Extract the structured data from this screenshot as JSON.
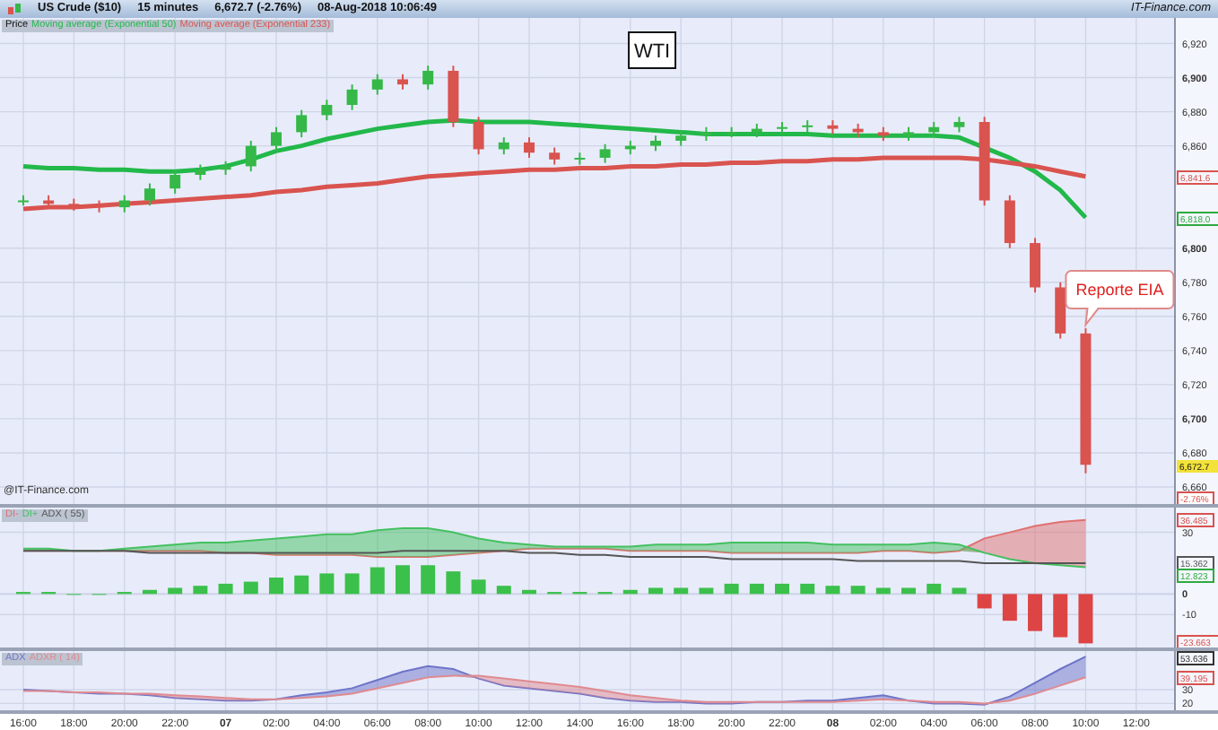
{
  "header": {
    "instrument": "US Crude ($10)",
    "interval": "15 minutes",
    "quote": "6,672.7 (-2.76%)",
    "timestamp": "08-Aug-2018 10:06:49",
    "site": "IT-Finance.com"
  },
  "price_panel": {
    "credit": "@IT-Finance.com",
    "price_legend": "Price",
    "tags": [
      {
        "label": "6,841.6",
        "kind": "outline",
        "color": "#d9534f"
      },
      {
        "label": "6,818.0",
        "kind": "outline",
        "color": "#2eaa40"
      },
      {
        "label": "6,672.7",
        "kind": "filled",
        "color": "#f2e23a"
      },
      {
        "label": "-2.76%",
        "kind": "change",
        "color": "#d9534f"
      }
    ],
    "chart_data": {
      "type": "candlestick",
      "title": "WTI",
      "grid": true,
      "ylim": [
        6650,
        6935
      ],
      "categories": [
        null,
        null,
        null,
        null,
        null,
        null,
        null,
        null,
        null,
        null,
        null,
        null,
        null,
        null,
        null,
        null,
        null,
        null,
        null,
        null,
        null,
        null,
        null,
        null,
        null,
        null,
        null,
        null,
        null,
        null,
        null,
        null,
        null,
        null,
        null,
        null,
        null,
        null,
        null,
        null,
        null,
        null,
        null
      ],
      "yticks": [
        {
          "value": 6920,
          "label": "6,920"
        },
        {
          "value": 6900,
          "label": "6,900"
        },
        {
          "value": 6880,
          "label": "6,880"
        },
        {
          "value": 6860,
          "label": "6,860"
        },
        {
          "value": 6800,
          "label": "6,800"
        },
        {
          "value": 6780,
          "label": "6,780"
        },
        {
          "value": 6760,
          "label": "6,760"
        },
        {
          "value": 6740,
          "label": "6,740"
        },
        {
          "value": 6720,
          "label": "6,720"
        },
        {
          "value": 6700,
          "label": "6,700"
        },
        {
          "value": 6680,
          "label": "6,680"
        },
        {
          "value": 6660,
          "label": "6,660"
        }
      ],
      "ohlc": [
        [
          6828,
          6831,
          6825,
          6828
        ],
        [
          6828,
          6831,
          6823,
          6826
        ],
        [
          6826,
          6829,
          6822,
          6825
        ],
        [
          6825,
          6828,
          6821,
          6824
        ],
        [
          6824,
          6831,
          6821,
          6828
        ],
        [
          6828,
          6838,
          6825,
          6835
        ],
        [
          6835,
          6846,
          6832,
          6843
        ],
        [
          6843,
          6849,
          6840,
          6846
        ],
        [
          6846,
          6851,
          6843,
          6848
        ],
        [
          6848,
          6863,
          6845,
          6860
        ],
        [
          6860,
          6871,
          6857,
          6868
        ],
        [
          6868,
          6881,
          6865,
          6878
        ],
        [
          6878,
          6887,
          6875,
          6884
        ],
        [
          6884,
          6896,
          6881,
          6893
        ],
        [
          6893,
          6902,
          6890,
          6899
        ],
        [
          6899,
          6902,
          6893,
          6896
        ],
        [
          6896,
          6907,
          6893,
          6904
        ],
        [
          6904,
          6907,
          6871,
          6874
        ],
        [
          6874,
          6877,
          6855,
          6858
        ],
        [
          6858,
          6865,
          6855,
          6862
        ],
        [
          6862,
          6865,
          6853,
          6856
        ],
        [
          6856,
          6859,
          6849,
          6852
        ],
        [
          6852,
          6856,
          6849,
          6853
        ],
        [
          6853,
          6861,
          6850,
          6858
        ],
        [
          6858,
          6863,
          6855,
          6860
        ],
        [
          6860,
          6866,
          6857,
          6863
        ],
        [
          6863,
          6869,
          6860,
          6866
        ],
        [
          6866,
          6871,
          6863,
          6868
        ],
        [
          6868,
          6871,
          6865,
          6868
        ],
        [
          6868,
          6873,
          6865,
          6870
        ],
        [
          6870,
          6874,
          6867,
          6871
        ],
        [
          6871,
          6875,
          6868,
          6872
        ],
        [
          6872,
          6875,
          6867,
          6870
        ],
        [
          6870,
          6873,
          6865,
          6868
        ],
        [
          6868,
          6871,
          6863,
          6866
        ],
        [
          6866,
          6871,
          6863,
          6868
        ],
        [
          6868,
          6874,
          6865,
          6871
        ],
        [
          6871,
          6877,
          6868,
          6874
        ],
        [
          6874,
          6877,
          6825,
          6828
        ],
        [
          6828,
          6831,
          6800,
          6803
        ],
        [
          6803,
          6806,
          6774,
          6777
        ],
        [
          6777,
          6780,
          6747,
          6750
        ],
        [
          6750,
          6753,
          6668,
          6673
        ]
      ],
      "series": [
        {
          "name": "Moving average (Exponential 50)",
          "type": "line",
          "color": "#22b84a",
          "values": [
            6848,
            6847,
            6847,
            6846,
            6846,
            6845,
            6845,
            6846,
            6848,
            6852,
            6857,
            6860,
            6864,
            6867,
            6870,
            6872,
            6874,
            6875,
            6874,
            6874,
            6874,
            6873,
            6872,
            6871,
            6870,
            6869,
            6868,
            6867,
            6867,
            6867,
            6867,
            6867,
            6866,
            6866,
            6866,
            6866,
            6866,
            6865,
            6859,
            6853,
            6845,
            6834,
            6818
          ]
        },
        {
          "name": "Moving average (Exponential 233)",
          "type": "line",
          "color": "#d9534f",
          "values": [
            6823,
            6824,
            6824,
            6825,
            6826,
            6827,
            6828,
            6829,
            6830,
            6831,
            6833,
            6834,
            6836,
            6837,
            6838,
            6840,
            6842,
            6843,
            6844,
            6845,
            6846,
            6846,
            6847,
            6847,
            6848,
            6848,
            6849,
            6849,
            6850,
            6850,
            6851,
            6851,
            6852,
            6852,
            6853,
            6853,
            6853,
            6853,
            6852,
            6850,
            6848,
            6845,
            6842
          ]
        }
      ],
      "annotations": [
        "Reporte EIA"
      ]
    }
  },
  "di_panel": {
    "tags": [
      {
        "label": "36.485",
        "kind": "outline",
        "color": "#d9534f"
      },
      {
        "label": "15.362",
        "kind": "outline",
        "color": "#555555"
      },
      {
        "label": "12.823",
        "kind": "outline",
        "color": "#2eaa40"
      },
      {
        "label": "-23.663",
        "kind": "outline",
        "color": "#d9534f"
      }
    ],
    "chart_data": {
      "type": "line",
      "grid": true,
      "ylim": [
        -26,
        42
      ],
      "categories": [
        null,
        null,
        null,
        null,
        null,
        null,
        null,
        null,
        null,
        null,
        null,
        null,
        null,
        null,
        null,
        null,
        null,
        null,
        null,
        null,
        null,
        null,
        null,
        null,
        null,
        null,
        null,
        null,
        null,
        null,
        null,
        null,
        null,
        null,
        null,
        null,
        null,
        null,
        null,
        null,
        null,
        null,
        null
      ],
      "yticks": [
        {
          "value": 30,
          "label": "30"
        },
        {
          "value": 0,
          "label": "0"
        },
        {
          "value": -10,
          "label": "-10"
        }
      ],
      "series": [
        {
          "name": "DI-",
          "type": "area",
          "color": "#e07070",
          "values": [
            21,
            21,
            21,
            21,
            21,
            21,
            21,
            21,
            20,
            20,
            19,
            19,
            19,
            19,
            18,
            18,
            18,
            19,
            20,
            21,
            22,
            22,
            22,
            22,
            21,
            21,
            21,
            21,
            20,
            20,
            20,
            20,
            20,
            20,
            21,
            21,
            20,
            21,
            27,
            30,
            33,
            35,
            36
          ]
        },
        {
          "name": "DI+",
          "type": "area",
          "color": "#44c060",
          "values": [
            22,
            22,
            21,
            21,
            22,
            23,
            24,
            25,
            25,
            26,
            27,
            28,
            29,
            29,
            31,
            32,
            32,
            30,
            27,
            25,
            24,
            23,
            23,
            23,
            23,
            24,
            24,
            24,
            25,
            25,
            25,
            25,
            24,
            24,
            24,
            24,
            25,
            24,
            20,
            17,
            15,
            14,
            13
          ]
        },
        {
          "name": "ADX ( 55)",
          "type": "line",
          "color": "#555555",
          "values": [
            21,
            21,
            21,
            21,
            21,
            20,
            20,
            20,
            20,
            20,
            20,
            20,
            20,
            20,
            20,
            21,
            21,
            21,
            21,
            21,
            20,
            20,
            19,
            19,
            18,
            18,
            18,
            18,
            17,
            17,
            17,
            17,
            17,
            16,
            16,
            16,
            16,
            16,
            15,
            15,
            15,
            15,
            15
          ]
        },
        {
          "type": "bar",
          "color": "#3cc04c",
          "values": [
            1,
            1,
            0,
            0,
            1,
            2,
            3,
            4,
            5,
            6,
            8,
            9,
            10,
            10,
            13,
            14,
            14,
            11,
            7,
            4,
            2,
            1,
            1,
            1,
            2,
            3,
            3,
            3,
            5,
            5,
            5,
            5,
            4,
            4,
            3,
            3,
            5,
            3,
            null,
            null,
            null,
            null,
            null
          ]
        },
        {
          "type": "bar",
          "color": "#dd4444",
          "values": [
            null,
            null,
            null,
            null,
            null,
            null,
            null,
            null,
            null,
            null,
            null,
            null,
            null,
            null,
            null,
            null,
            null,
            null,
            null,
            null,
            null,
            null,
            null,
            null,
            null,
            null,
            null,
            null,
            null,
            null,
            null,
            null,
            null,
            null,
            null,
            null,
            null,
            null,
            -7,
            -13,
            -18,
            -21,
            -24
          ]
        }
      ]
    }
  },
  "adx_panel": {
    "tags": [
      {
        "label": "53.636",
        "kind": "outline",
        "color": "#333333"
      },
      {
        "label": "39.195",
        "kind": "outline",
        "color": "#d9534f"
      }
    ],
    "chart_data": {
      "type": "line",
      "grid": true,
      "ylim": [
        15,
        58
      ],
      "categories": [
        "16:00",
        null,
        "18:00",
        null,
        "20:00",
        null,
        "22:00",
        null,
        "07",
        null,
        "02:00",
        null,
        "04:00",
        null,
        "06:00",
        null,
        "08:00",
        null,
        "10:00",
        null,
        "12:00",
        null,
        "14:00",
        null,
        "16:00",
        null,
        "18:00",
        null,
        "20:00",
        null,
        "22:00",
        null,
        "08",
        null,
        "02:00",
        null,
        "04:00",
        null,
        "06:00",
        null,
        "08:00",
        null,
        "10:00",
        null,
        "12:00"
      ],
      "yticks": [
        {
          "value": 30,
          "label": "30"
        },
        {
          "value": 20,
          "label": "20"
        }
      ],
      "series": [
        {
          "name": "ADX",
          "type": "area",
          "color": "#6e74c8",
          "values": [
            30,
            29,
            28,
            27,
            27,
            26,
            24,
            23,
            22,
            22,
            23,
            26,
            28,
            31,
            37,
            43,
            47,
            45,
            38,
            33,
            31,
            29,
            27,
            24,
            22,
            21,
            21,
            20,
            20,
            21,
            21,
            22,
            22,
            24,
            26,
            22,
            20,
            20,
            19,
            25,
            35,
            45,
            54,
            null,
            null
          ]
        },
        {
          "name": "ADXR ( 14)",
          "type": "area",
          "color": "#e08a90",
          "values": [
            29,
            29,
            28,
            28,
            27,
            27,
            26,
            25,
            24,
            23,
            23,
            24,
            25,
            27,
            31,
            35,
            39,
            40,
            40,
            38,
            36,
            34,
            32,
            29,
            26,
            24,
            22,
            21,
            21,
            21,
            21,
            21,
            21,
            22,
            23,
            22,
            21,
            21,
            20,
            22,
            27,
            33,
            39,
            null,
            null
          ]
        }
      ]
    }
  }
}
